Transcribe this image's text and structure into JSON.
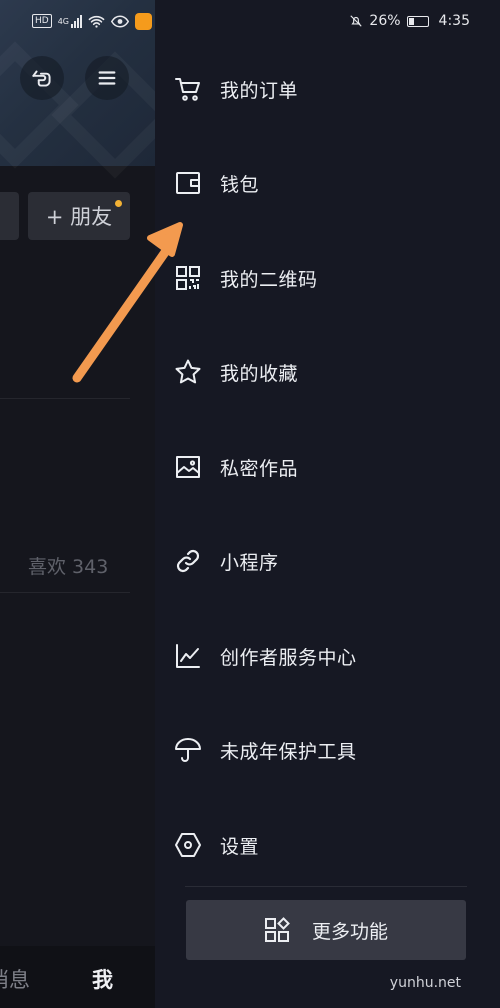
{
  "status_bar": {
    "network": "4G",
    "hd_badge": "HD",
    "battery": "26%",
    "time": "4:35"
  },
  "background_page": {
    "add_friend_label": "+ 朋友",
    "likes_text": "喜欢 343",
    "bottom_tabs": [
      "消息",
      "我"
    ]
  },
  "drawer": {
    "menu_items": [
      {
        "label": "我的订单",
        "icon": "shopping-cart-icon"
      },
      {
        "label": "钱包",
        "icon": "wallet-icon"
      },
      {
        "label": "我的二维码",
        "icon": "qr-code-icon"
      },
      {
        "label": "我的收藏",
        "icon": "star-icon"
      },
      {
        "label": "私密作品",
        "icon": "private-image-icon"
      },
      {
        "label": "小程序",
        "icon": "link-icon"
      },
      {
        "label": "创作者服务中心",
        "icon": "chart-icon"
      },
      {
        "label": "未成年保护工具",
        "icon": "umbrella-icon"
      },
      {
        "label": "设置",
        "icon": "settings-hexagon-icon"
      }
    ],
    "more_button_label": "更多功能"
  },
  "annotation": {
    "arrow_color": "#f39a4f"
  },
  "watermark": "yunhu.net"
}
